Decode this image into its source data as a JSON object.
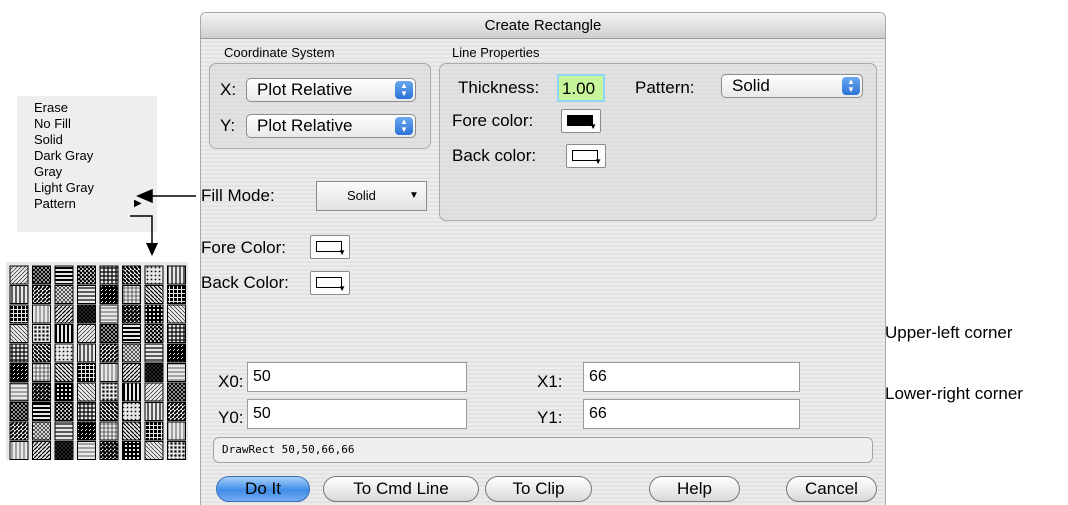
{
  "dialog": {
    "title": "Create Rectangle",
    "coord_group": "Coordinate System",
    "x_label": "X:",
    "x_value": "Plot Relative",
    "y_label": "Y:",
    "y_value": "Plot Relative",
    "line_group": "Line Properties",
    "thickness_label": "Thickness:",
    "thickness_value": "1.00",
    "pattern_label": "Pattern:",
    "pattern_value": "Solid",
    "line_fore_label": "Fore color:",
    "line_back_label": "Back color:",
    "fill_mode_label": "Fill Mode:",
    "fill_mode_value": "Solid",
    "fill_fore_label": "Fore Color:",
    "fill_back_label": "Back Color:",
    "x0_label": "X0:",
    "x0_value": "50",
    "y0_label": "Y0:",
    "y0_value": "50",
    "x1_label": "X1:",
    "x1_value": "66",
    "y1_label": "Y1:",
    "y1_value": "66",
    "command_text": "DrawRect 50,50,66,66",
    "buttons": {
      "do_it": "Do It",
      "to_cmd_line": "To Cmd Line",
      "to_clip": "To Clip",
      "help": "Help",
      "cancel": "Cancel"
    }
  },
  "fill_menu": {
    "items": [
      "Erase",
      "No Fill",
      "Solid",
      "Dark Gray",
      "Gray",
      "Light Gray",
      "Pattern"
    ]
  },
  "callouts": {
    "upper_left": "Upper-left corner",
    "lower_right": "Lower-right corner"
  },
  "colors": {
    "line_fore": "#000000",
    "line_back": "#ffffff",
    "fill_fore": "#ffffff",
    "fill_back": "#ffffff",
    "thickness_field": "#c6f59a",
    "default_button": "#3f8ce6"
  }
}
